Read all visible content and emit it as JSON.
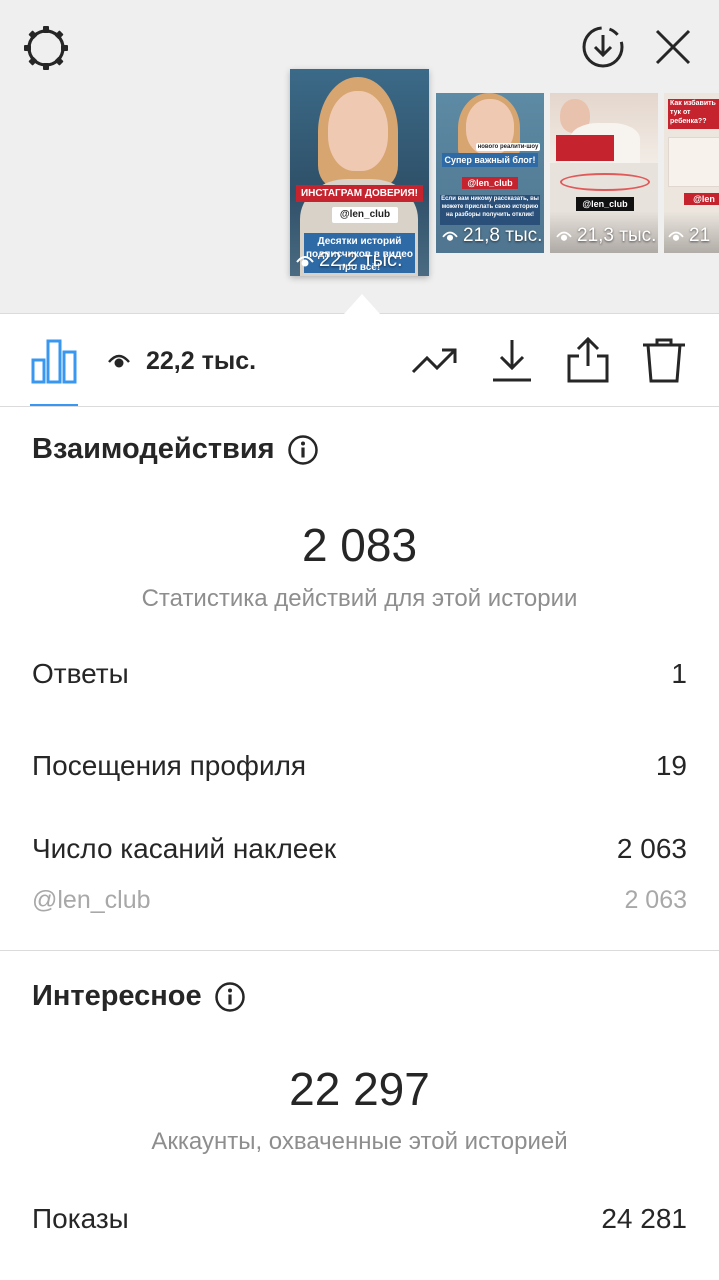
{
  "stories": [
    {
      "title_tag": "ИНСТАГРАМ ДОВЕРИЯ!",
      "handle": "@len_club",
      "caption": "Десятки историй подписчиков в видео про всё!",
      "views": "22,2 тыс."
    },
    {
      "top_note": "нового реалити-шоу",
      "title_tag": "Супер важный блог!",
      "handle": "@len_club",
      "caption": "Если вам никому рассказать, вы можете прислать свою историю на разборы получить отклик!",
      "views": "21,8 тыс."
    },
    {
      "handle": "@len_club",
      "views": "21,3 тыс."
    },
    {
      "title_tag": "Как избавить тук от ребенка??",
      "handle": "@len",
      "views": "21"
    }
  ],
  "toolbar": {
    "views": "22,2 тыс."
  },
  "interactions": {
    "title": "Взаимодействия",
    "total": "2 083",
    "subtitle": "Статистика действий для этой истории",
    "rows": [
      {
        "label": "Ответы",
        "value": "1"
      },
      {
        "label": "Посещения профиля",
        "value": "19"
      },
      {
        "label": "Число касаний наклеек",
        "value": "2 063"
      }
    ],
    "sub_row": {
      "label": "@len_club",
      "value": "2 063"
    }
  },
  "discovery": {
    "title": "Интересное",
    "total": "22 297",
    "subtitle": "Аккаунты, охваченные этой историей",
    "rows": [
      {
        "label": "Показы",
        "value": "24 281"
      }
    ]
  },
  "colors": {
    "accent": "#3897f0",
    "text": "#262626",
    "muted": "#8e8e8e",
    "tag_red": "#c5242f"
  },
  "icons": [
    "gear-icon",
    "download-circle-icon",
    "close-icon",
    "bar-chart-icon",
    "eye-icon",
    "trending-icon",
    "download-icon",
    "share-icon",
    "trash-icon",
    "info-icon"
  ]
}
